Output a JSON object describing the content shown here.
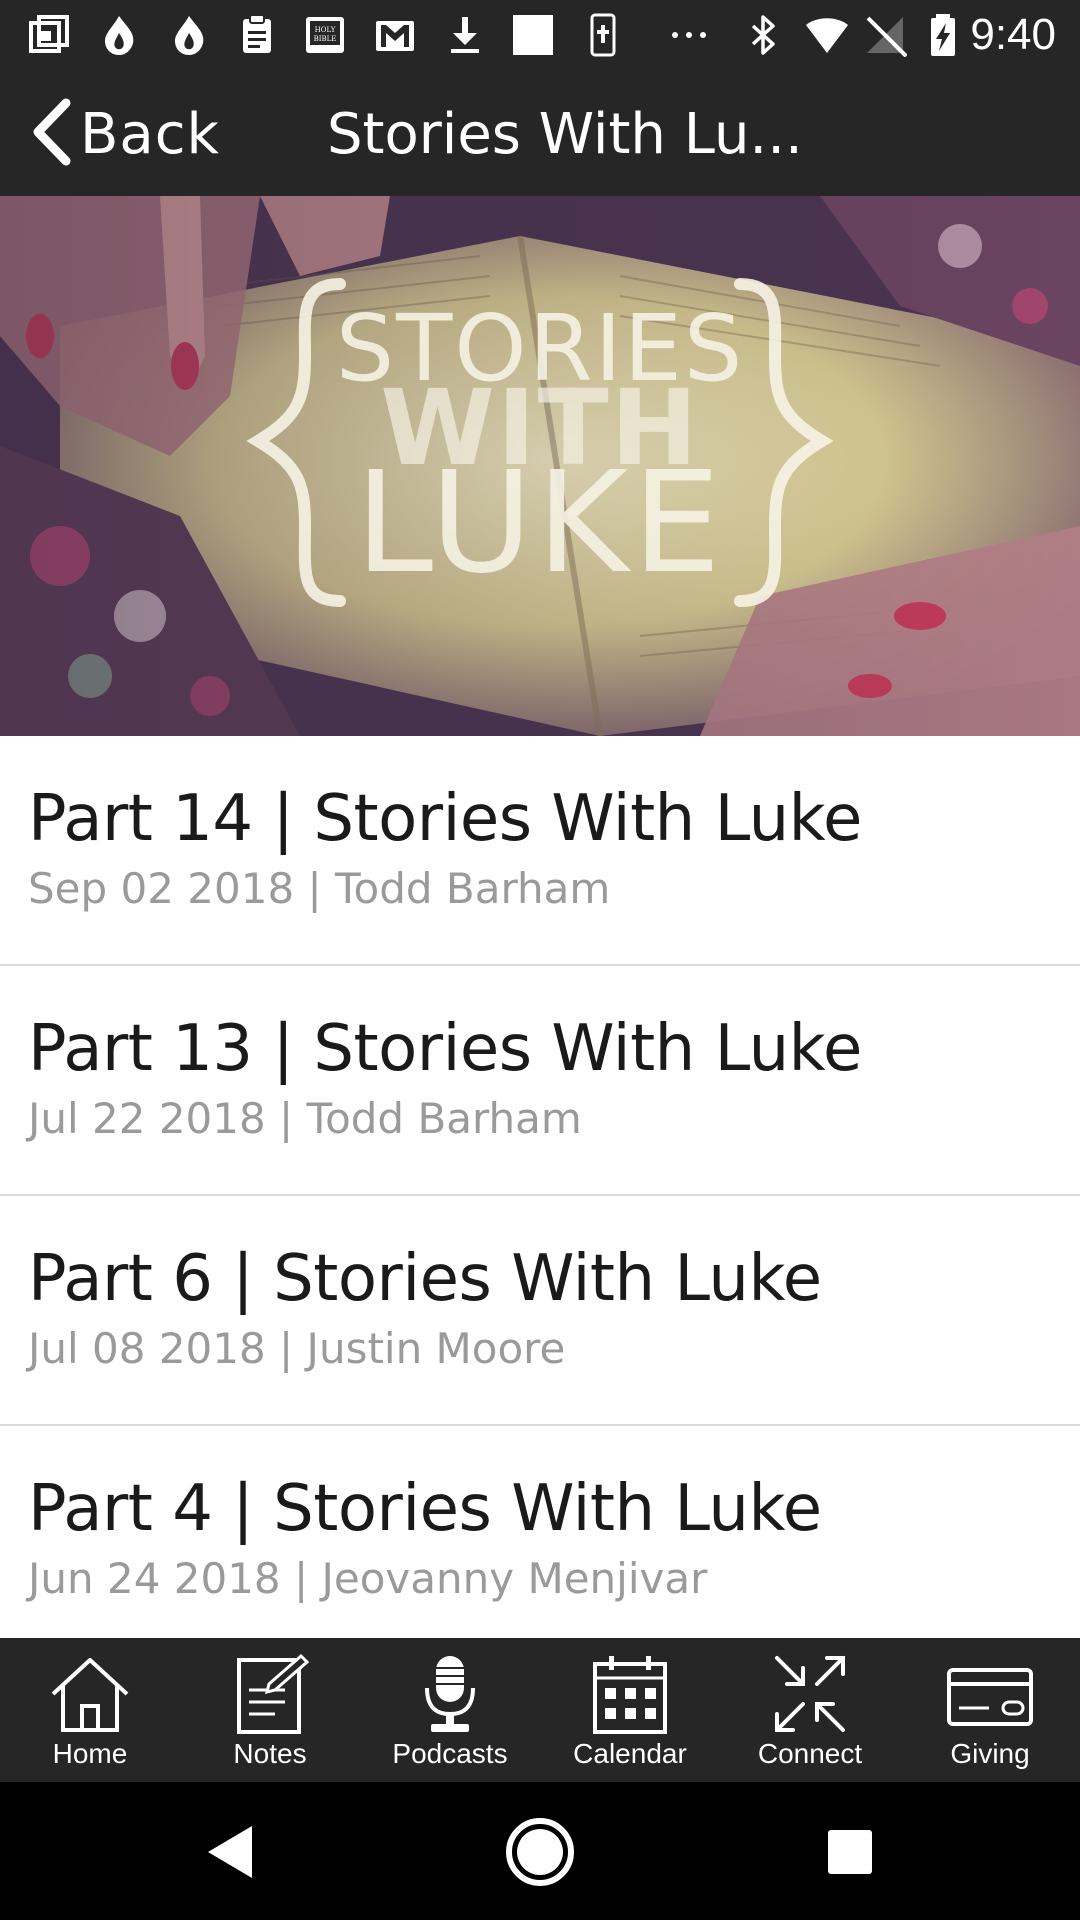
{
  "status_bar": {
    "time": "9:40",
    "icons": [
      "picture-in-picture-icon",
      "flame-icon",
      "flame-icon",
      "clipboard-icon",
      "holy-bible-icon",
      "gmail-icon",
      "download-icon",
      "blank-square-icon",
      "bible-cross-icon",
      "more-dots-icon",
      "bluetooth-icon",
      "wifi-icon",
      "no-signal-icon",
      "battery-charging-icon"
    ]
  },
  "nav": {
    "back_label": "Back",
    "title": "Stories With Lu..."
  },
  "banner": {
    "logo_line1": "STORIES",
    "logo_line2": "WITH",
    "logo_line3": "LUKE"
  },
  "list": {
    "items": [
      {
        "title": "Part 14 | Stories With Luke",
        "subtitle": "Sep 02 2018 | Todd Barham"
      },
      {
        "title": "Part 13 | Stories With Luke",
        "subtitle": "Jul 22 2018 | Todd Barham"
      },
      {
        "title": "Part 6 | Stories With Luke",
        "subtitle": "Jul 08 2018 | Justin Moore"
      },
      {
        "title": "Part 4 | Stories With Luke",
        "subtitle": "Jun 24 2018 | Jeovanny Menjivar"
      }
    ]
  },
  "tabs": [
    {
      "label": "Home",
      "icon": "home-icon"
    },
    {
      "label": "Notes",
      "icon": "notes-icon"
    },
    {
      "label": "Podcasts",
      "icon": "microphone-icon"
    },
    {
      "label": "Calendar",
      "icon": "calendar-icon"
    },
    {
      "label": "Connect",
      "icon": "connect-arrows-icon"
    },
    {
      "label": "Giving",
      "icon": "credit-card-icon"
    }
  ],
  "colors": {
    "bar_background": "#262626",
    "subtitle_gray": "#9a9a9a",
    "divider": "#d9d9d9"
  }
}
